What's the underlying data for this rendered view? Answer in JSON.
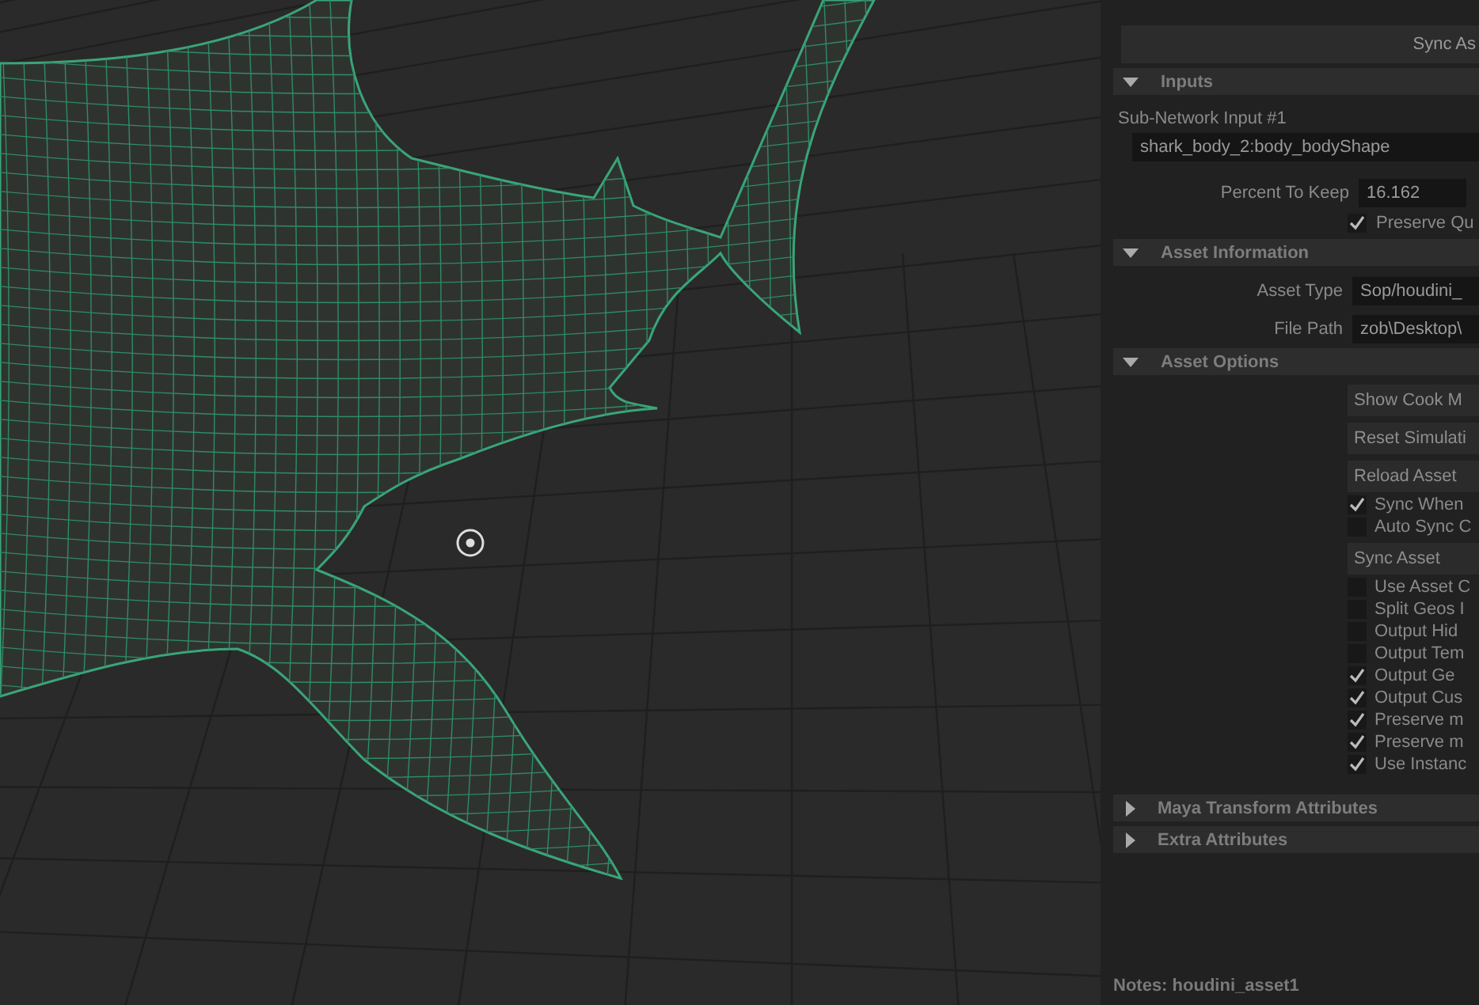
{
  "sync_button": "Sync As",
  "inputs": {
    "title": "Inputs",
    "expanded": true,
    "sub_network_label": "Sub-Network Input #1",
    "sub_network_value": "shark_body_2:body_bodyShape",
    "percent_label": "Percent To Keep",
    "percent_value": "16.162",
    "preserve": {
      "label": "Preserve Qu",
      "checked": true
    }
  },
  "asset_information": {
    "title": "Asset Information",
    "expanded": true,
    "fields": [
      {
        "label": "Asset Type",
        "value": "Sop/houdini_"
      },
      {
        "label": "File Path",
        "value": "zob\\Desktop\\"
      }
    ]
  },
  "asset_options": {
    "title": "Asset Options",
    "expanded": true,
    "items": [
      {
        "kind": "button",
        "label": "Show Cook M"
      },
      {
        "kind": "button",
        "label": "Reset Simulati"
      },
      {
        "kind": "button",
        "label": "Reload Asset"
      },
      {
        "kind": "checkbox",
        "label": "Sync When",
        "checked": true
      },
      {
        "kind": "checkbox",
        "label": "Auto Sync C",
        "checked": false
      },
      {
        "kind": "button",
        "label": "Sync Asset"
      },
      {
        "kind": "checkbox",
        "label": "Use Asset C",
        "checked": false
      },
      {
        "kind": "checkbox",
        "label": "Split Geos I",
        "checked": false
      },
      {
        "kind": "checkbox",
        "label": "Output Hid",
        "checked": false
      },
      {
        "kind": "checkbox",
        "label": "Output Tem",
        "checked": false
      },
      {
        "kind": "checkbox",
        "label": "Output Ge",
        "checked": true
      },
      {
        "kind": "checkbox",
        "label": "Output Cus",
        "checked": true
      },
      {
        "kind": "checkbox",
        "label": "Preserve m",
        "checked": true
      },
      {
        "kind": "checkbox",
        "label": "Preserve m",
        "checked": true
      },
      {
        "kind": "checkbox",
        "label": "Use Instanc",
        "checked": true
      }
    ]
  },
  "collapsed_sections": [
    {
      "title": "Maya Transform Attributes",
      "expanded": false
    },
    {
      "title": "Extra Attributes",
      "expanded": false
    }
  ],
  "notes": {
    "label": "Notes:",
    "value": "houdini_asset1"
  }
}
